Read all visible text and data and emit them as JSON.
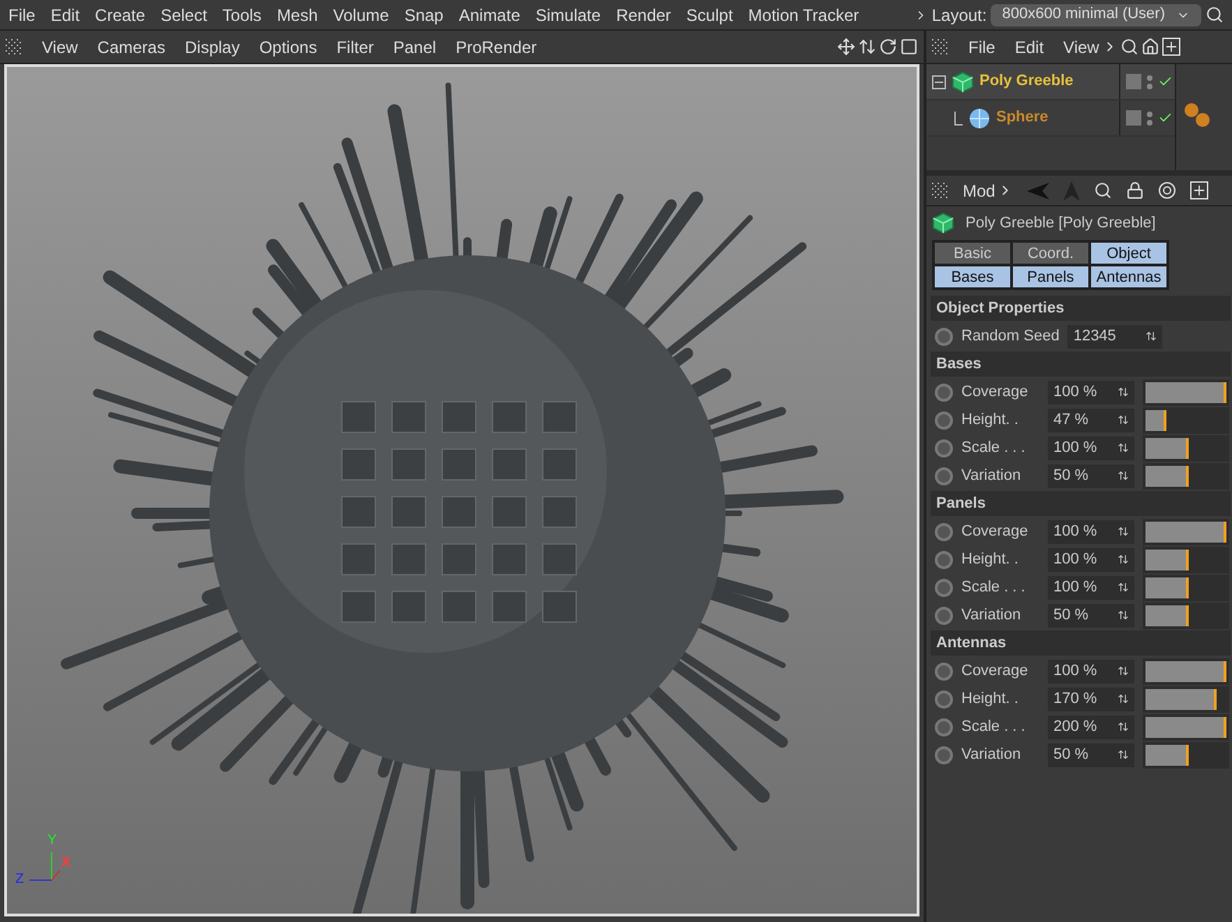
{
  "menu_bar": {
    "items": [
      "File",
      "Edit",
      "Create",
      "Select",
      "Tools",
      "Mesh",
      "Volume",
      "Snap",
      "Animate",
      "Simulate",
      "Render",
      "Sculpt",
      "Motion Tracker"
    ],
    "layout_label": "Layout:",
    "layout_value": "800x600 minimal (User)"
  },
  "viewport": {
    "menu": [
      "View",
      "Cameras",
      "Display",
      "Options",
      "Filter",
      "Panel",
      "ProRender"
    ],
    "axis_labels": {
      "y": "Y",
      "x": "X",
      "z": "Z"
    }
  },
  "object_manager": {
    "menu": [
      "File",
      "Edit",
      "View"
    ],
    "objects": [
      {
        "name": "Poly Greeble",
        "expanded": true,
        "children": [
          {
            "name": "Sphere"
          }
        ]
      }
    ]
  },
  "attributes": {
    "menu_label": "Mod",
    "object_title": "Poly Greeble [Poly Greeble]",
    "tabs": [
      {
        "label": "Basic",
        "selected": false
      },
      {
        "label": "Coord.",
        "selected": false
      },
      {
        "label": "Object",
        "selected": true
      },
      {
        "label": "Bases",
        "selected": true
      },
      {
        "label": "Panels",
        "selected": true
      },
      {
        "label": "Antennas",
        "selected": true
      }
    ],
    "sections": [
      {
        "title": "Object Properties",
        "rows": [
          {
            "kind": "number",
            "label": "Random Seed",
            "value": "12345"
          }
        ]
      },
      {
        "title": "Bases",
        "rows": [
          {
            "kind": "slider",
            "label": "Coverage",
            "value": "100 %",
            "level": 1
          },
          {
            "kind": "slider",
            "label": "Height. .",
            "value": "47 %",
            "level": 0.25
          },
          {
            "kind": "slider",
            "label": "Scale . . .",
            "value": "100 %",
            "level": 0.53
          },
          {
            "kind": "slider",
            "label": "Variation",
            "value": "50 %",
            "level": 0.53
          }
        ]
      },
      {
        "title": "Panels",
        "rows": [
          {
            "kind": "slider",
            "label": "Coverage",
            "value": "100 %",
            "level": 1
          },
          {
            "kind": "slider",
            "label": "Height. .",
            "value": "100 %",
            "level": 0.53
          },
          {
            "kind": "slider",
            "label": "Scale . . .",
            "value": "100 %",
            "level": 0.53
          },
          {
            "kind": "slider",
            "label": "Variation",
            "value": "50 %",
            "level": 0.53
          }
        ]
      },
      {
        "title": "Antennas",
        "rows": [
          {
            "kind": "slider",
            "label": "Coverage",
            "value": "100 %",
            "level": 1
          },
          {
            "kind": "slider",
            "label": "Height. .",
            "value": "170 %",
            "level": 0.88
          },
          {
            "kind": "slider",
            "label": "Scale . . .",
            "value": "200 %",
            "level": 1
          },
          {
            "kind": "slider",
            "label": "Variation",
            "value": "50 %",
            "level": 0.53
          }
        ]
      }
    ]
  }
}
